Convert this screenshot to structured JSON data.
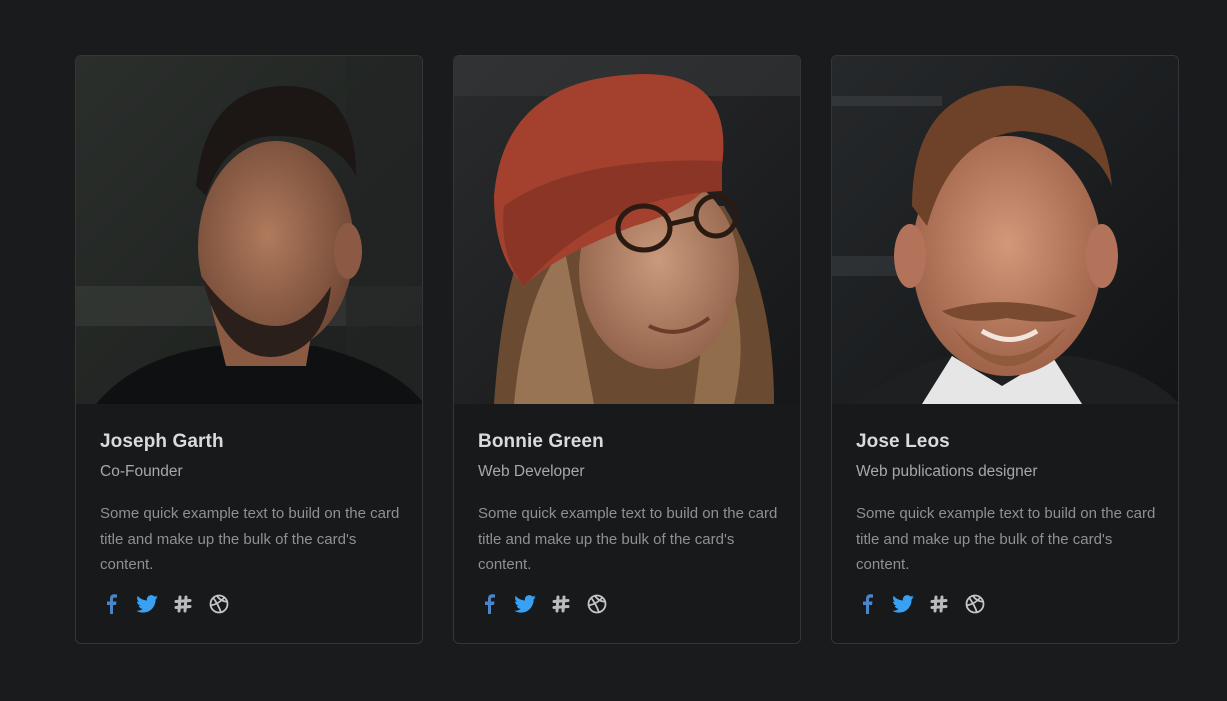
{
  "cards": [
    {
      "name": "Joseph Garth",
      "role": "Co-Founder",
      "description": "Some quick example text to build on the card title and make up the bulk of the card's content.",
      "social": [
        "facebook-icon",
        "twitter-icon",
        "slack-icon",
        "dribbble-icon"
      ]
    },
    {
      "name": "Bonnie Green",
      "role": "Web Developer",
      "description": "Some quick example text to build on the card title and make up the bulk of the card's content.",
      "social": [
        "facebook-icon",
        "twitter-icon",
        "slack-icon",
        "dribbble-icon"
      ]
    },
    {
      "name": "Jose Leos",
      "role": "Web publications designer",
      "description": "Some quick example text to build on the card title and make up the bulk of the card's content.",
      "social": [
        "facebook-icon",
        "twitter-icon",
        "slack-icon",
        "dribbble-icon"
      ]
    }
  ],
  "colors": {
    "background": "#1a1b1d",
    "card_border": "#33363a",
    "facebook": "#4b85c9",
    "twitter": "#38a1f3",
    "slack": "#b9bbbe",
    "dribbble": "#c4c6c9"
  }
}
